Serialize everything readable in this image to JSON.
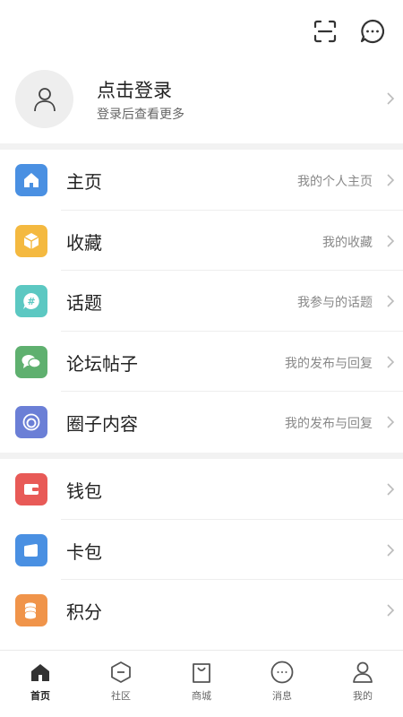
{
  "header": {
    "scan_icon": "scan-icon",
    "message_icon": "chat-bubble-icon"
  },
  "profile": {
    "title": "点击登录",
    "subtitle": "登录后查看更多"
  },
  "menu_group_1": [
    {
      "label": "主页",
      "sub": "我的个人主页",
      "icon": "home-icon",
      "color": "#4a90e2"
    },
    {
      "label": "收藏",
      "sub": "我的收藏",
      "icon": "box-icon",
      "color": "#f4b940"
    },
    {
      "label": "话题",
      "sub": "我参与的话题",
      "icon": "hashtag-icon",
      "color": "#5cc8c2"
    },
    {
      "label": "论坛帖子",
      "sub": "我的发布与回复",
      "icon": "forum-icon",
      "color": "#5fb06f"
    },
    {
      "label": "圈子内容",
      "sub": "我的发布与回复",
      "icon": "circle-icon",
      "color": "#6b7fd6"
    }
  ],
  "menu_group_2": [
    {
      "label": "钱包",
      "icon": "wallet-icon",
      "color": "#e85a57"
    },
    {
      "label": "卡包",
      "icon": "card-icon",
      "color": "#4a90e2"
    },
    {
      "label": "积分",
      "icon": "coins-icon",
      "color": "#f0944a"
    }
  ],
  "tabbar": [
    {
      "label": "首页",
      "icon": "home-icon",
      "active": true
    },
    {
      "label": "社区",
      "icon": "community-icon",
      "active": false
    },
    {
      "label": "商城",
      "icon": "shopping-bag-icon",
      "active": false
    },
    {
      "label": "消息",
      "icon": "message-icon",
      "active": false
    },
    {
      "label": "我的",
      "icon": "user-icon",
      "active": false
    }
  ]
}
